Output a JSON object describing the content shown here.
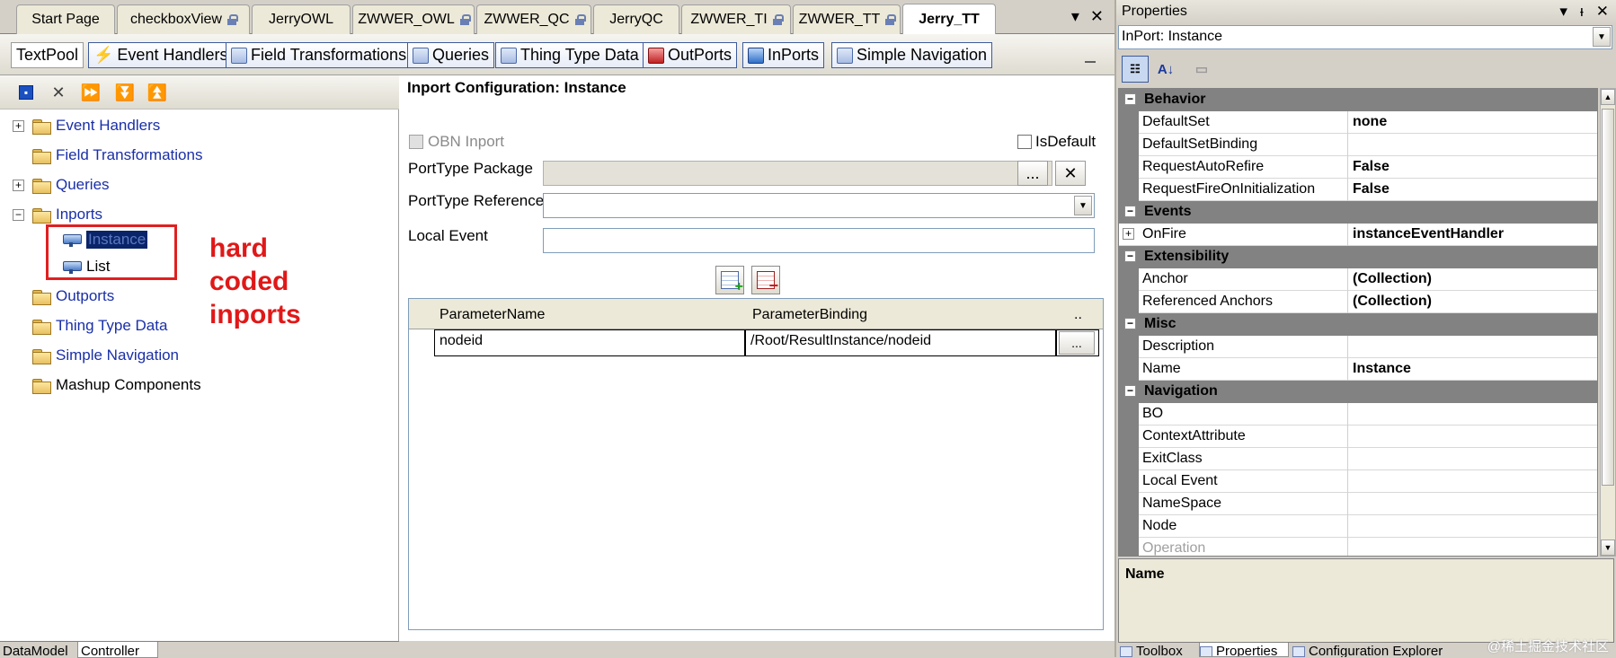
{
  "doc_tabs": [
    "Start Page",
    "checkboxView",
    "JerryOWL",
    "ZWWER_OWL",
    "ZWWER_QC",
    "JerryQC",
    "ZWWER_TI",
    "ZWWER_TT",
    "Jerry_TT"
  ],
  "doc_tab_controls": {
    "dropdown": "▾",
    "close": "✕"
  },
  "toolbar": {
    "textpool": "TextPool",
    "event_handlers": "Event Handlers",
    "field_transformations": "Field Transformations",
    "queries": "Queries",
    "thing_type_data": "Thing Type Data",
    "outports": "OutPorts",
    "inports": "InPorts",
    "simple_navigation": "Simple Navigation"
  },
  "tree": {
    "items": [
      "Event Handlers",
      "Field Transformations",
      "Queries",
      "Inports",
      "Instance",
      "List",
      "Outports",
      "Thing Type Data",
      "Simple Navigation",
      "Mashup Components"
    ]
  },
  "annotation": {
    "line1": "hard",
    "line2": "coded",
    "line3": "inports"
  },
  "config": {
    "title": "Inport Configuration: Instance",
    "obn_inport": "OBN Inport",
    "is_default": "IsDefault",
    "porttype_package": "PortType Package",
    "porttype_reference": "PortType Reference",
    "local_event": "Local Event",
    "browse": "...",
    "clear": "✕"
  },
  "params": {
    "col_name": "ParameterName",
    "col_binding": "ParameterBinding",
    "col_extra": "..",
    "rows": [
      {
        "name": "nodeid",
        "binding": "/Root/ResultInstance/nodeid",
        "btn": "..."
      }
    ]
  },
  "bottom_tabs": [
    "DataModel",
    "Controller"
  ],
  "properties": {
    "title": "Properties",
    "header_ctl": [
      "▾",
      "ᵻ",
      "✕"
    ],
    "object": "InPort: Instance",
    "categories": {
      "behavior": "Behavior",
      "events": "Events",
      "extensibility": "Extensibility",
      "misc": "Misc",
      "navigation": "Navigation"
    },
    "rows": {
      "defaultset": {
        "name": "DefaultSet",
        "value": "none"
      },
      "defaultsetbinding": {
        "name": "DefaultSetBinding",
        "value": ""
      },
      "requestautorefire": {
        "name": "RequestAutoRefire",
        "value": "False"
      },
      "requestfireoninit": {
        "name": "RequestFireOnInitialization",
        "value": "False"
      },
      "onfire": {
        "name": "OnFire",
        "value": "instanceEventHandler"
      },
      "anchor": {
        "name": "Anchor",
        "value": "(Collection)"
      },
      "refanchors": {
        "name": "Referenced Anchors",
        "value": "(Collection)"
      },
      "description": {
        "name": "Description",
        "value": ""
      },
      "name": {
        "name": "Name",
        "value": "Instance"
      },
      "bo": {
        "name": "BO",
        "value": ""
      },
      "contextattr": {
        "name": "ContextAttribute",
        "value": ""
      },
      "exitclass": {
        "name": "ExitClass",
        "value": ""
      },
      "localevent": {
        "name": "Local Event",
        "value": ""
      },
      "namespace": {
        "name": "NameSpace",
        "value": ""
      },
      "node": {
        "name": "Node",
        "value": ""
      },
      "operation": {
        "name": "Operation",
        "value": ""
      }
    },
    "desc_title": "Name",
    "bottom_tabs": [
      "Toolbox",
      "Properties",
      "Configuration Explorer"
    ]
  },
  "watermark": "@稀土掘金技术社区"
}
